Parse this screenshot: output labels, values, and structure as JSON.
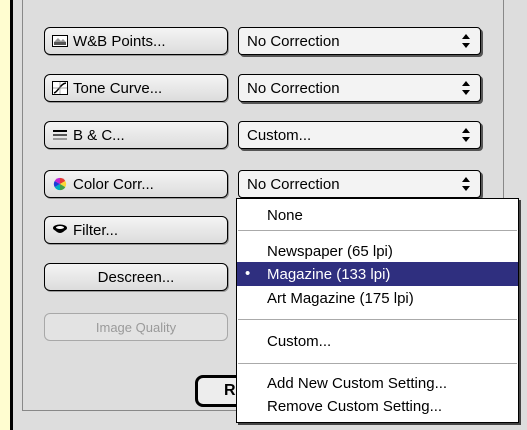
{
  "buttons": {
    "wb_points": "W&B Points...",
    "tone_curve": "Tone Curve...",
    "bc": "B & C...",
    "color_corr": "Color Corr...",
    "filter": "Filter...",
    "descreen": "Descreen...",
    "image_quality": "Image Quality",
    "r_button": "R"
  },
  "popups": {
    "wb_points_value": "No Correction",
    "tone_curve_value": "No Correction",
    "bc_value": "Custom...",
    "color_corr_value": "No Correction"
  },
  "descreen_menu": {
    "selected": "Magazine (133 lpi)",
    "items": [
      {
        "label": "None"
      },
      {
        "label": "Newspaper (65 lpi)"
      },
      {
        "label": "Magazine (133 lpi)",
        "checked": true
      },
      {
        "label": "Art Magazine (175 lpi)"
      },
      {
        "label": "Custom..."
      },
      {
        "label": "Add New Custom Setting..."
      },
      {
        "label": "Remove Custom Setting..."
      }
    ],
    "check_mark": "•"
  },
  "colors": {
    "highlight": "#2f2f7f",
    "panel": "#dddddd",
    "background": "#fffdd0"
  }
}
